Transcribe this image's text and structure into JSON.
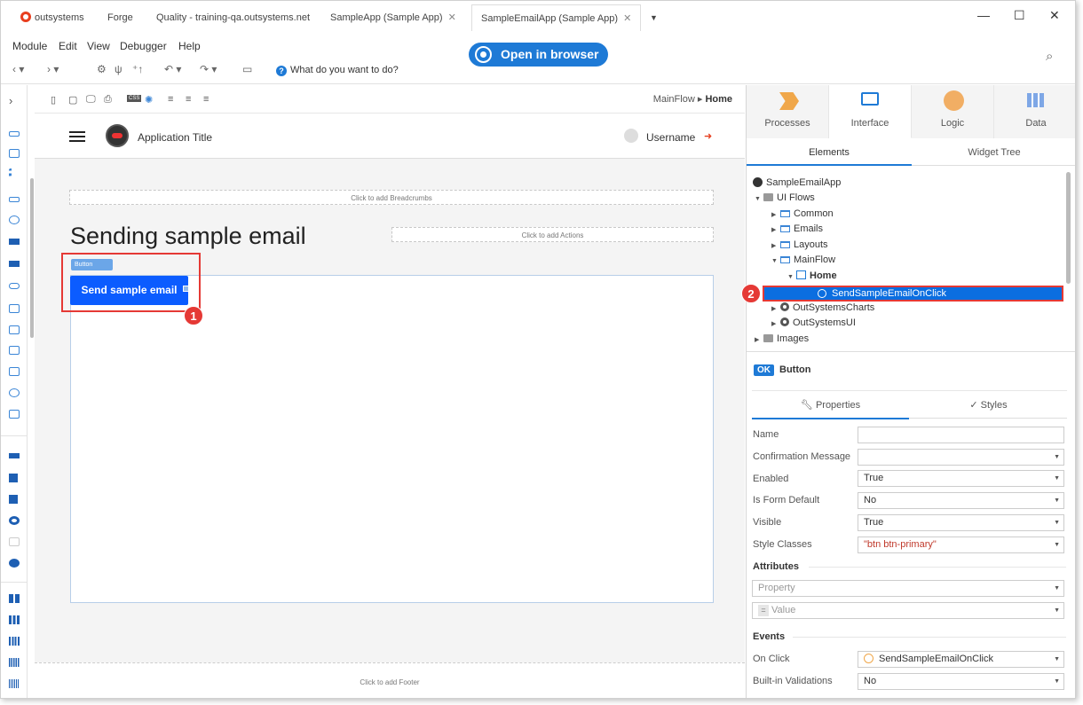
{
  "tabs": {
    "brand": "outsystems",
    "forge": "Forge",
    "quality": "Quality - training-qa.outsystems.net",
    "sampleapp": "SampleApp (Sample App)",
    "sampleemail": "SampleEmailApp (Sample App)"
  },
  "menu": {
    "module": "Module",
    "edit": "Edit",
    "view": "View",
    "debugger": "Debugger",
    "help": "Help",
    "open_in_browser": "Open in browser",
    "what_do": "What do you want to do?"
  },
  "canvas_toolbar": {
    "breadcrumb_flow": "MainFlow",
    "breadcrumb_sep": "▸",
    "breadcrumb_page": "Home"
  },
  "canvas": {
    "app_title": "Application Title",
    "username": "Username",
    "breadcrumbs_placeholder": "Click to add Breadcrumbs",
    "page_title": "Sending sample email",
    "actions_placeholder": "Click to add Actions",
    "button_tag": "Button",
    "send_button": "Send sample email",
    "footer_placeholder": "Click to add Footer",
    "callout_1": "1",
    "callout_2": "2"
  },
  "right_panel": {
    "tabs": [
      "Processes",
      "Interface",
      "Logic",
      "Data"
    ],
    "subtabs": [
      "Elements",
      "Widget Tree"
    ],
    "tree": {
      "app": "SampleEmailApp",
      "ui_flows": "UI Flows",
      "common": "Common",
      "emails": "Emails",
      "layouts": "Layouts",
      "mainflow": "MainFlow",
      "home": "Home",
      "selected": "SendSampleEmailOnClick",
      "charts": "OutSystemsCharts",
      "ui": "OutSystemsUI",
      "images": "Images"
    },
    "widget_type_badge": "OK",
    "widget_type": "Button",
    "prop_tabs": [
      "Properties",
      "Styles"
    ],
    "properties": {
      "name_label": "Name",
      "name_value": "",
      "confirm_label": "Confirmation Message",
      "confirm_value": "",
      "enabled_label": "Enabled",
      "enabled_value": "True",
      "formdefault_label": "Is Form Default",
      "formdefault_value": "No",
      "visible_label": "Visible",
      "visible_value": "True",
      "style_label": "Style Classes",
      "style_value": "\"btn btn-primary\""
    },
    "attributes_title": "Attributes",
    "attr_property_placeholder": "Property",
    "attr_value_placeholder": "Value",
    "events_title": "Events",
    "onclick_label": "On Click",
    "onclick_value": "SendSampleEmailOnClick",
    "builtin_label": "Built-in Validations",
    "builtin_value": "No"
  },
  "colors": {
    "accent": "#1e7ad6",
    "primary_button": "#0b5cff",
    "highlight": "#e53935"
  }
}
